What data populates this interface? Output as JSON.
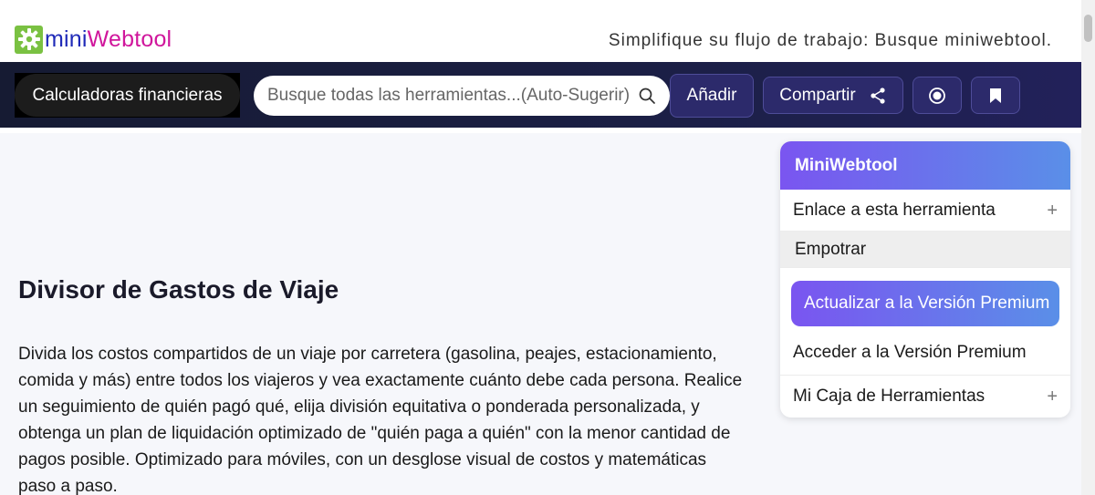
{
  "header": {
    "logo_mini": "mini",
    "logo_web": "Webtool",
    "tagline": "Simplifique su flujo de trabajo: Busque miniwebtool."
  },
  "nav": {
    "category_label": "Calculadoras financieras",
    "search_placeholder": "Busque todas las herramientas...(Auto-Sugerir)",
    "add_label": "Añadir",
    "share_label": "Compartir"
  },
  "main": {
    "title": "Divisor de Gastos de Viaje",
    "description": "Divida los costos compartidos de un viaje por carretera (gasolina, peajes, estacionamiento, comida y más) entre todos los viajeros y vea exactamente cuánto debe cada persona. Realice un seguimiento de quién pagó qué, elija división equitativa o ponderada personalizada, y obtenga un plan de liquidación optimizado de \"quién paga a quién\" con la menor cantidad de pagos posible. Optimizado para móviles, con un desglose visual de costos y matemáticas paso a paso."
  },
  "panel": {
    "title": "MiniWebtool",
    "link_tool": "Enlace a esta herramienta",
    "embed": "Empotrar",
    "upgrade": "Actualizar a la Versión Premium",
    "access": "Acceder a la Versión Premium",
    "toolbox": "Mi Caja de Herramientas"
  },
  "colors": {
    "brand_green": "#7ac142",
    "brand_blue": "#1f2ab8",
    "brand_magenta": "#d0169c",
    "nav_bg": "#1b1f45",
    "accent_purple": "#7a55f0",
    "accent_blue": "#5a8fe8"
  }
}
